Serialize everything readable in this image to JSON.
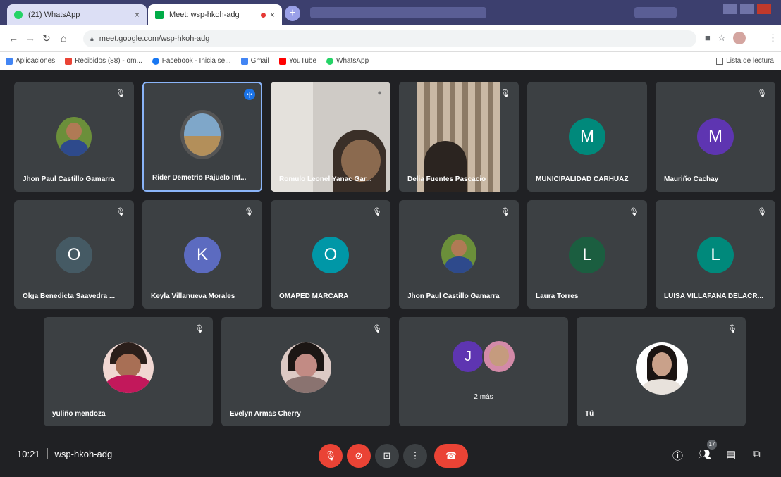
{
  "browser": {
    "tabs": [
      {
        "title": "(21) WhatsApp",
        "close": "×"
      },
      {
        "title": "Meet: wsp-hkoh-adg",
        "close": "×"
      }
    ],
    "new_tab": "+",
    "url": "meet.google.com/wsp-hkoh-adg",
    "bookmarks": [
      {
        "label": "Aplicaciones",
        "color": "#4285f4"
      },
      {
        "label": "Recibidos (88) - om...",
        "color": "#ea4335"
      },
      {
        "label": "Facebook - Inicia se...",
        "color": "#1877f2"
      },
      {
        "label": "Gmail",
        "color": "#4285f4"
      },
      {
        "label": "YouTube",
        "color": "#ff0000"
      },
      {
        "label": "WhatsApp",
        "color": "#25d366"
      }
    ],
    "reading_list": "Lista de lectura"
  },
  "participants": [
    {
      "name": "Jhon Paul Castillo Gamarra",
      "kind": "photo",
      "color": "#6b8f3a"
    },
    {
      "name": "Rider Demetrio Pajuelo Inf...",
      "kind": "photo",
      "color": "#7fa7c9"
    },
    {
      "name": "Romulo Leonel Yanac Gar...",
      "kind": "video",
      "color": "#c9c5c0"
    },
    {
      "name": "Delia Fuentes Pascacio",
      "kind": "video",
      "color": "#b89a80"
    },
    {
      "name": "MUNICIPALIDAD CARHUAZ",
      "initial": "M",
      "color": "#00897b"
    },
    {
      "name": "Mauriño Cachay",
      "initial": "M",
      "color": "#5e35b1"
    },
    {
      "name": "Olga Benedicta Saavedra ...",
      "initial": "O",
      "color": "#455a64"
    },
    {
      "name": "Keyla Villanueva Morales",
      "initial": "K",
      "color": "#5c6bc0"
    },
    {
      "name": "OMAPED MARCARA",
      "initial": "O",
      "color": "#0097a7"
    },
    {
      "name": "Jhon Paul Castillo Gamarra",
      "kind": "photo",
      "color": "#6b8f3a"
    },
    {
      "name": "Laura Torres",
      "initial": "L",
      "color": "#1b5e40"
    },
    {
      "name": "LUISA VILLAFANA DELACR...",
      "initial": "L",
      "color": "#00897b"
    },
    {
      "name": "yuliño mendoza",
      "kind": "photo",
      "color": "#c2185b"
    },
    {
      "name": "Evelyn Armas Cherry",
      "kind": "photo",
      "color": "#c28b84"
    },
    {
      "name": "",
      "initial": "J",
      "more": "2 más",
      "color": "#5e35b1"
    },
    {
      "name": "Tú",
      "kind": "photo",
      "color": "#f5f5f5"
    }
  ],
  "bottom": {
    "time": "10:21",
    "meeting_code": "wsp-hkoh-adg",
    "people_count": "17"
  }
}
